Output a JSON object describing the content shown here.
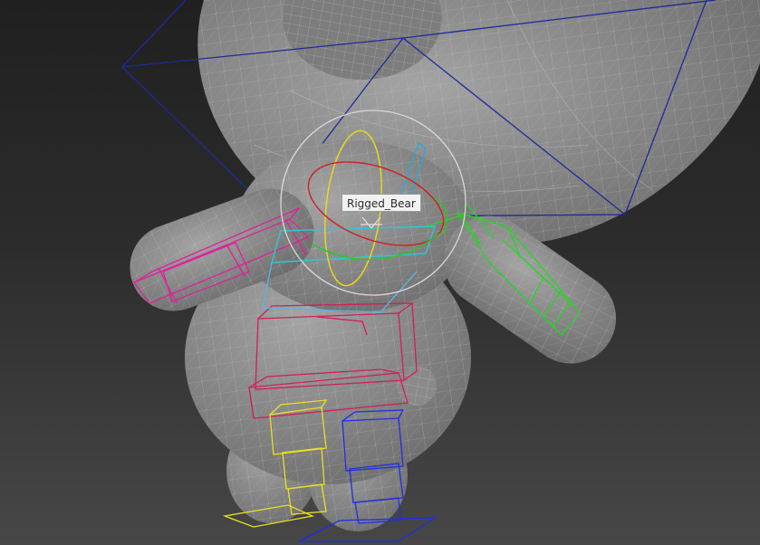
{
  "viewport": {
    "object_tooltip": "Rigged_Bear"
  },
  "colors": {
    "background_top": "#202020",
    "background_bottom": "#474747",
    "mesh_fill": "#8e8e8e",
    "mesh_wire": "#d0d0d0",
    "helper_box": "#1f2a9a",
    "spine_bones": "#d21e5a",
    "left_arm_bones": "#e0209a",
    "right_arm_bones": "#22d822",
    "left_leg_bones": "#e8e020",
    "right_leg_bones": "#2030e0",
    "gizmo_x": "#d02020",
    "gizmo_y": "#22cc22",
    "gizmo_z": "#e8d81c",
    "gizmo_screen": "#d8d8d8",
    "head_bone": "#2aa8d8"
  }
}
